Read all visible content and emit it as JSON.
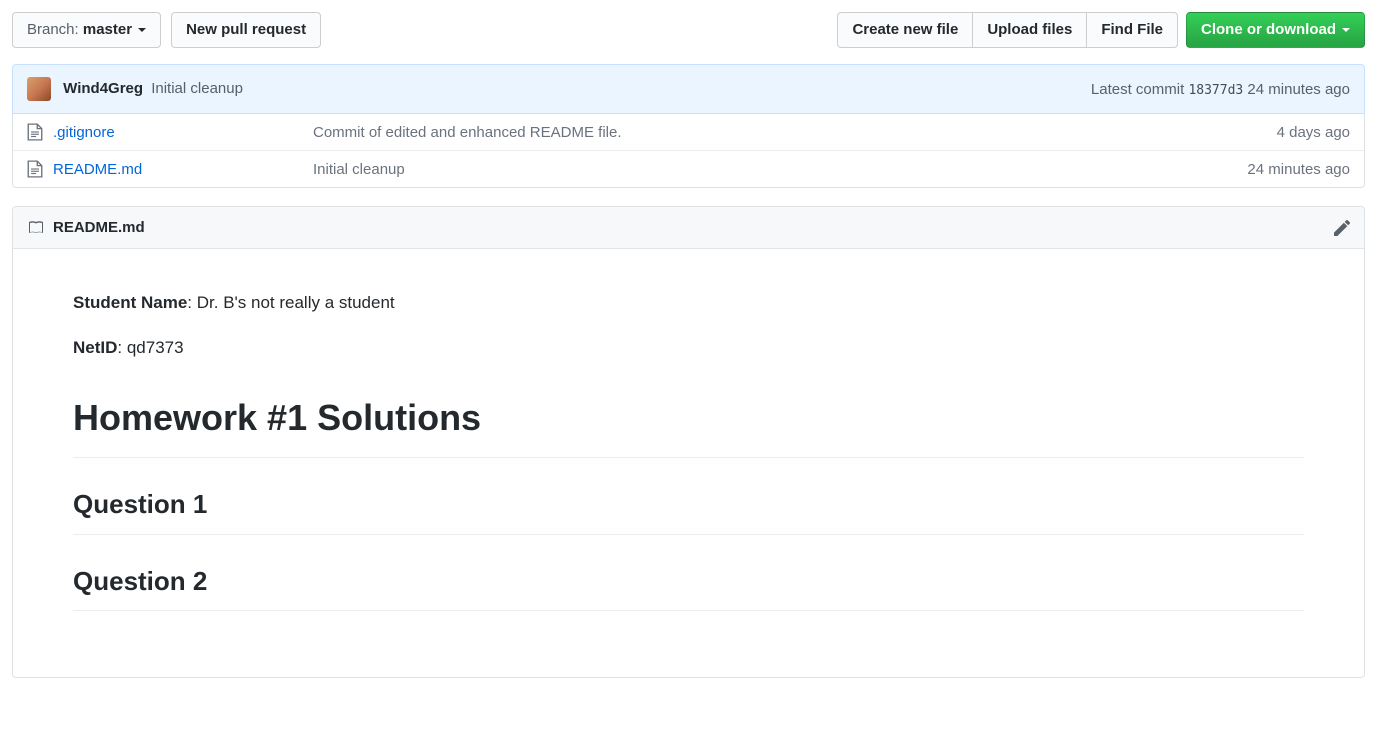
{
  "toolbar": {
    "branch_label": "Branch:",
    "branch_name": "master",
    "new_pr": "New pull request",
    "create_file": "Create new file",
    "upload": "Upload files",
    "find": "Find File",
    "clone": "Clone or download"
  },
  "commit_tease": {
    "author": "Wind4Greg",
    "message": "Initial cleanup",
    "latest_prefix": "Latest commit",
    "sha": "18377d3",
    "age": "24 minutes ago"
  },
  "files": [
    {
      "name": ".gitignore",
      "message": "Commit of edited and enhanced README file.",
      "age": "4 days ago"
    },
    {
      "name": "README.md",
      "message": "Initial cleanup",
      "age": "24 minutes ago"
    }
  ],
  "readme": {
    "filename": "README.md",
    "student_label": "Student Name",
    "student_value": ": Dr. B's not really a student",
    "netid_label": "NetID",
    "netid_value": ": qd7373",
    "h1": "Homework #1 Solutions",
    "q1": "Question 1",
    "q2": "Question 2"
  }
}
